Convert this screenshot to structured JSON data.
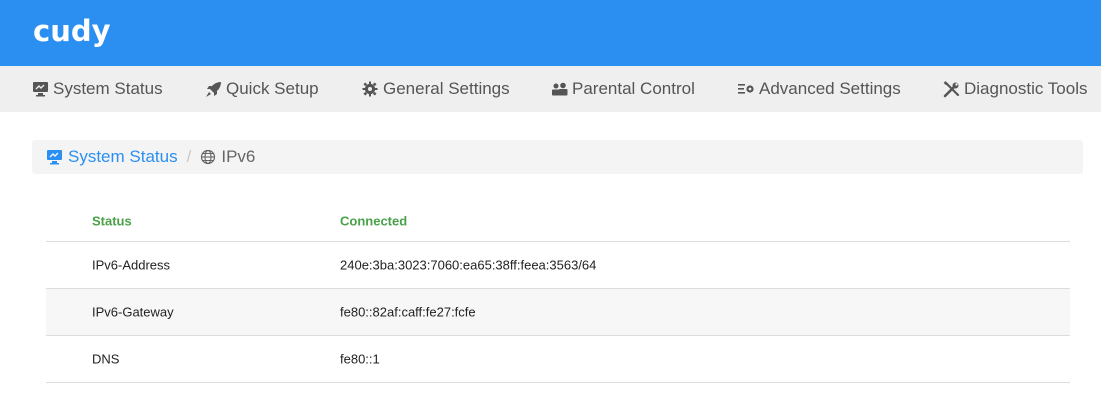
{
  "brand": {
    "logo_text": "cudy",
    "color": "#2b8ff2"
  },
  "nav": {
    "items": [
      {
        "label": "System Status",
        "icon": "monitor-icon"
      },
      {
        "label": "Quick Setup",
        "icon": "rocket-icon"
      },
      {
        "label": "General Settings",
        "icon": "gear-icon"
      },
      {
        "label": "Parental Control",
        "icon": "users-icon"
      },
      {
        "label": "Advanced Settings",
        "icon": "list-gear-icon"
      },
      {
        "label": "Diagnostic Tools",
        "icon": "tools-icon"
      }
    ]
  },
  "breadcrumb": {
    "parent": "System Status",
    "separator": "/",
    "current": "IPv6"
  },
  "table": {
    "header": {
      "key": "Status",
      "value": "Connected"
    },
    "rows": [
      {
        "key": "IPv6-Address",
        "value": "240e:3ba:3023:7060:ea65:38ff:feea:3563/64"
      },
      {
        "key": "IPv6-Gateway",
        "value": "fe80::82af:caff:fe27:fcfe"
      },
      {
        "key": "DNS",
        "value": "fe80::1"
      }
    ]
  },
  "colors": {
    "status_green": "#4aa14a",
    "nav_bg": "#efefef"
  }
}
